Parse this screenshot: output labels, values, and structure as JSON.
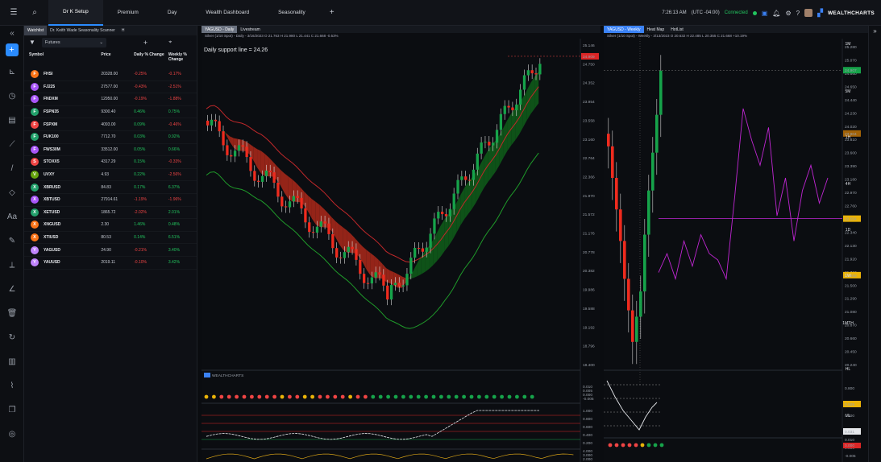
{
  "topbar": {
    "tabs": [
      "Dr K Setup",
      "Premium",
      "Day",
      "Wealth Dashboard",
      "Seasonality"
    ],
    "active_tab": 0,
    "time": "7:26:13 AM",
    "timezone": "(UTC -04:00)",
    "status": "Connected",
    "brand": "WEALTHCHARTS"
  },
  "watchlist": {
    "tabs": [
      "Watchlist",
      "Dr. Keith Wade Seasonality Scanner",
      "H"
    ],
    "filter": "Futures",
    "headers": {
      "symbol": "Symbol",
      "price": "Price",
      "daily": "Daily % Change",
      "weekly": "Weekly % Change"
    },
    "rows": [
      {
        "letter": "F",
        "color": "#f97316",
        "symbol": "FHSI",
        "price": "20328.00",
        "daily": "-0.25%",
        "weekly": "-0.17%",
        "dneg": true,
        "wneg": true
      },
      {
        "letter": "F",
        "color": "#a855f7",
        "symbol": "FJ225",
        "price": "27577.00",
        "daily": "-0.43%",
        "weekly": "-2.51%",
        "dneg": true,
        "wneg": true
      },
      {
        "letter": "F",
        "color": "#a855f7",
        "symbol": "FNDXM",
        "price": "12950.00",
        "daily": "-0.19%",
        "weekly": "-1.88%",
        "dneg": true,
        "wneg": true
      },
      {
        "letter": "F",
        "color": "#22a06b",
        "symbol": "FSPN35",
        "price": "9300.40",
        "daily": "0.46%",
        "weekly": "0.75%",
        "dneg": false,
        "wneg": false
      },
      {
        "letter": "F",
        "color": "#ef4444",
        "symbol": "FSPXM",
        "price": "4093.00",
        "daily": "0.09%",
        "weekly": "-0.46%",
        "dneg": false,
        "wneg": true
      },
      {
        "letter": "F",
        "color": "#22a06b",
        "symbol": "FUK100",
        "price": "7712.70",
        "daily": "0.03%",
        "weekly": "0.92%",
        "dneg": false,
        "wneg": false
      },
      {
        "letter": "F",
        "color": "#a855f7",
        "symbol": "FWS30M",
        "price": "33512.00",
        "daily": "0.05%",
        "weekly": "0.66%",
        "dneg": false,
        "wneg": false
      },
      {
        "letter": "S",
        "color": "#ef4444",
        "symbol": "STOXX5",
        "price": "4317.29",
        "daily": "0.15%",
        "weekly": "-0.33%",
        "dneg": false,
        "wneg": true
      },
      {
        "letter": "V",
        "color": "#65a30d",
        "symbol": "UVXY",
        "price": "4.93",
        "daily": "0.22%",
        "weekly": "-2.56%",
        "dneg": false,
        "wneg": true
      },
      {
        "letter": "X",
        "color": "#22a06b",
        "symbol": "XBRUSD",
        "price": "84.83",
        "daily": "0.17%",
        "weekly": "6.37%",
        "dneg": false,
        "wneg": false
      },
      {
        "letter": "X",
        "color": "#a855f7",
        "symbol": "XBTUSD",
        "price": "27914.61",
        "daily": "-1.19%",
        "weekly": "-1.96%",
        "dneg": true,
        "wneg": true
      },
      {
        "letter": "X",
        "color": "#22a06b",
        "symbol": "XETUSD",
        "price": "1865.72",
        "daily": "-2.02%",
        "weekly": "2.01%",
        "dneg": true,
        "wneg": false
      },
      {
        "letter": "X",
        "color": "#f97316",
        "symbol": "XNGUSD",
        "price": "2.30",
        "daily": "1.46%",
        "weekly": "0.48%",
        "dneg": false,
        "wneg": false
      },
      {
        "letter": "X",
        "color": "#f97316",
        "symbol": "XTIUSD",
        "price": "80.53",
        "daily": "0.14%",
        "weekly": "6.51%",
        "dneg": false,
        "wneg": false
      },
      {
        "letter": "Y",
        "color": "#c084fc",
        "symbol": "YAGUSD",
        "price": "24.90",
        "daily": "-0.21%",
        "weekly": "3.40%",
        "dneg": true,
        "wneg": false
      },
      {
        "letter": "Y",
        "color": "#c084fc",
        "symbol": "YAUUSD",
        "price": "2019.11",
        "daily": "-0.10%",
        "weekly": "3.42%",
        "dneg": true,
        "wneg": false
      }
    ]
  },
  "daily_chart": {
    "tabs": [
      "YAGUSD - Daily",
      "Livestream"
    ],
    "ohlc": "Silver (1/10 Spot) - Daily - 3/16/2023 O 21.763 H 21.980 L 21.441 C 21.668 -0.53%",
    "annotation": "Daily support line = 24.26",
    "price_labels": [
      "25.146",
      "24.750",
      "24.352",
      "23.954",
      "23.558",
      "23.160",
      "22.764",
      "22.366",
      "21.970",
      "21.572",
      "21.176",
      "20.778",
      "20.382",
      "19.986",
      "19.588",
      "19.192",
      "18.796",
      "18.400"
    ],
    "current_price": "24.909",
    "sub_brand": "WEALTHCHARTS",
    "ind1_labels": [
      "0.010",
      "0.005",
      "0.000",
      "-0.005"
    ],
    "ind2_labels": [
      "1.000",
      "0.800",
      "0.600",
      "0.400",
      "0.200"
    ],
    "ind3_labels": [
      "4.000",
      "3.000",
      "2.000",
      "1.000"
    ]
  },
  "weekly_chart": {
    "tabs": [
      "YAGUSD - Weekly",
      "Heat Map",
      "HotList"
    ],
    "ohlc": "Silver (1/10 Spot) - Weekly - 3/13/2023 O 20.632 H 22.485 L 20.355 C 21.668 +10.19%",
    "price_labels": [
      "25.280",
      "25.070",
      "24.860",
      "24.650",
      "24.440",
      "24.230",
      "24.020",
      "23.810",
      "23.600",
      "23.390",
      "23.180",
      "22.970",
      "22.760",
      "22.550",
      "22.340",
      "22.130",
      "21.920",
      "21.710",
      "21.500",
      "21.290",
      "21.080",
      "20.870",
      "20.660",
      "20.450",
      "20.240"
    ],
    "tag_current": "24.907",
    "tag_mid": "23.904",
    "tag_line": "22.554",
    "tag_low": "21.658",
    "ind_labels": [
      "0.800",
      "0.600",
      "0.400",
      "0.200"
    ],
    "ind_tag": "0.509",
    "ind_tag2": "0.031",
    "bottom_labels": [
      "0.010",
      "0.000",
      "-0.005"
    ],
    "bottom_tag": "0.000",
    "timeframes": [
      "1M",
      "5M",
      "1H",
      "4H",
      "1D",
      "1W",
      "1MTH",
      "HL",
      "VL"
    ]
  }
}
